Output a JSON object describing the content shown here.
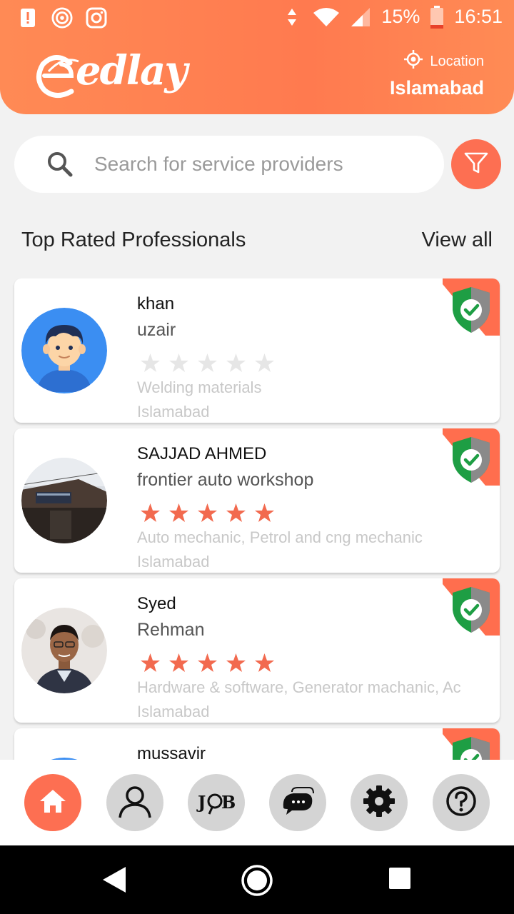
{
  "status_bar": {
    "battery": "15%",
    "time": "16:51"
  },
  "app": {
    "logo_text": "edlay"
  },
  "location": {
    "label": "Location",
    "city": "Islamabad"
  },
  "search": {
    "placeholder": "Search for service providers"
  },
  "section": {
    "title": "Top Rated Professionals",
    "view_all": "View all"
  },
  "professionals": [
    {
      "name": "khan",
      "company": "uzair",
      "rating": 0,
      "services": "Welding materials",
      "city": "Islamabad",
      "verified": true
    },
    {
      "name": "SAJJAD AHMED",
      "company": "frontier auto workshop",
      "rating": 5,
      "services": "Auto mechanic, Petrol and cng mechanic",
      "city": "Islamabad",
      "verified": true
    },
    {
      "name": "Syed",
      "company": "Rehman",
      "rating": 5,
      "services": "Hardware & software, Generator machanic, Ac",
      "city": "Islamabad",
      "verified": true
    },
    {
      "name": "mussavir",
      "company": "",
      "rating": 0,
      "services": "",
      "city": "",
      "verified": true
    }
  ],
  "bottom_nav": [
    {
      "icon": "home-icon",
      "active": true
    },
    {
      "icon": "profile-icon",
      "active": false
    },
    {
      "icon": "job-icon",
      "label": "JOB",
      "active": false
    },
    {
      "icon": "chat-icon",
      "active": false
    },
    {
      "icon": "settings-icon",
      "active": false
    },
    {
      "icon": "help-icon",
      "active": false
    }
  ],
  "colors": {
    "accent": "#fd6f52",
    "header": "#ff8052",
    "star_on": "#f26a4f",
    "star_off": "#e6e6e6"
  }
}
